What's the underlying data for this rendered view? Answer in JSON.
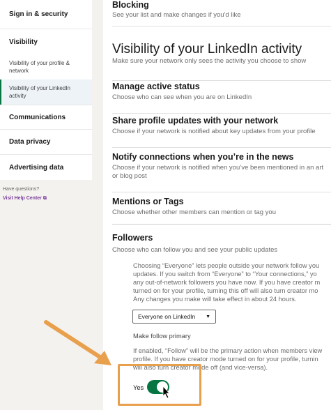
{
  "sidebar": {
    "items": [
      {
        "label": "Sign in & security"
      },
      {
        "label": "Visibility"
      },
      {
        "label": "Visibility of your profile & network"
      },
      {
        "label": "Visibility of your LinkedIn activity"
      },
      {
        "label": "Communications"
      },
      {
        "label": "Data privacy"
      },
      {
        "label": "Advertising data"
      }
    ],
    "help_text": "Have questions?",
    "help_link": "Visit Help Center"
  },
  "main": {
    "blocking": {
      "title": "Blocking",
      "desc": "See your list and make changes if you'd like"
    },
    "section_title": "Visibility of your LinkedIn activity",
    "section_desc": "Make sure your network only sees the activity you choose to show",
    "rows": [
      {
        "title": "Manage active status",
        "desc": "Choose who can see when you are on LinkedIn"
      },
      {
        "title": "Share profile updates with your network",
        "desc": "Choose if your network is notified about key updates from your profile"
      },
      {
        "title": "Notify connections when you’re in the news",
        "desc": "Choose if your network is notified when you’ve been mentioned in an art",
        "desc2": "or blog post"
      },
      {
        "title": "Mentions or Tags",
        "desc": "Choose whether other members can mention or tag you"
      }
    ],
    "followers": {
      "title": "Followers",
      "desc": "Choose who can follow you and see your public updates",
      "note_lines": [
        "Choosing “Everyone” lets people outside your network follow you",
        "updates. If you switch from “Everyone” to “Your connections,” yo",
        "any out-of-network followers you have now. If you have creator m",
        "turned on for your profile, turning this off will also turn creator mo",
        "Any changes you make will take effect in about 24 hours."
      ],
      "select_value": "Everyone on LinkedIn",
      "primary_label": "Make follow primary",
      "primary_lines": [
        "If enabled, “Follow” will be the primary action when members view",
        "profile. If you have creator mode turned on for your profile, turnin",
        "will also turn creator mode off (and vice-versa)."
      ],
      "toggle_label": "Yes",
      "toggle_on": true
    }
  },
  "colors": {
    "accent": "#057642",
    "annotation": "#e9a04d",
    "link": "#7a3e9c"
  }
}
